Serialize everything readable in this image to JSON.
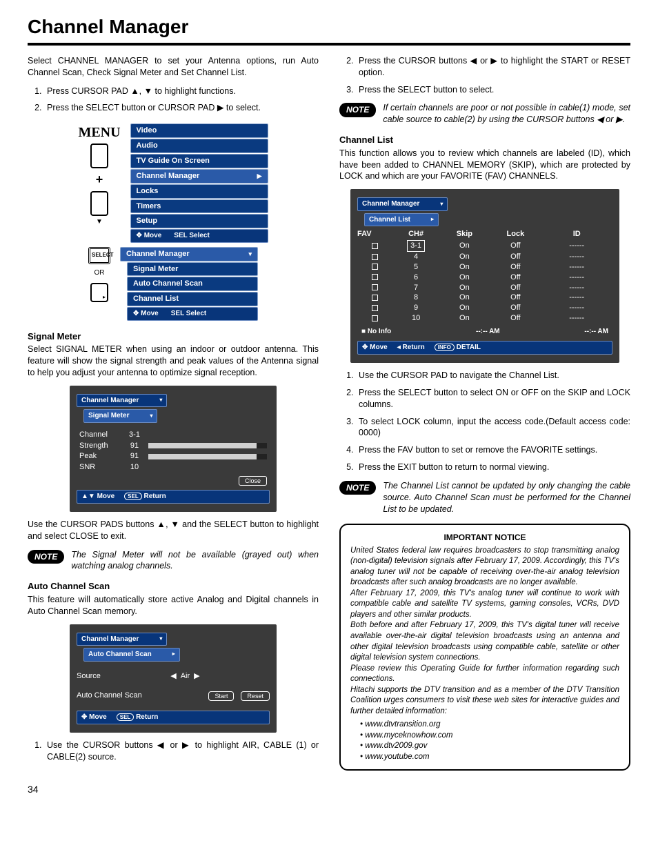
{
  "page": {
    "title": "Channel Manager",
    "number": "34"
  },
  "left": {
    "intro": "Select CHANNEL MANAGER to set your Antenna options, run Auto Channel Scan, Check Signal Meter and Set Channel List.",
    "step1": "Press CURSOR PAD ▲, ▼ to highlight functions.",
    "step2": "Press the SELECT button or CURSOR PAD ▶ to select.",
    "menu_word": "MENU",
    "menu_items": {
      "a": "Video",
      "b": "Audio",
      "c": "TV Guide On Screen",
      "d": "Channel Manager",
      "e": "Locks",
      "f": "Timers",
      "g": "Setup"
    },
    "menu_hint_move": "Move",
    "menu_hint_select": "Select",
    "sel_badge": "SEL",
    "select_label": "SELECT",
    "or_label": "OR",
    "sub_title": "Channel Manager",
    "sub_items": {
      "a": "Signal Meter",
      "b": "Auto Channel Scan",
      "c": "Channel List"
    },
    "sig_head": "Signal Meter",
    "sig_text": "Select SIGNAL METER when using an indoor or outdoor antenna. This feature will show the signal strength and peak values of the Antenna signal to help you adjust your antenna to optimize signal reception.",
    "sig_panel": {
      "crumb1": "Channel Manager",
      "crumb2": "Signal Meter",
      "r1l": "Channel",
      "r1v": "3-1",
      "r2l": "Strength",
      "r2v": "91",
      "r3l": "Peak",
      "r3v": "91",
      "r4l": "SNR",
      "r4v": "10",
      "close": "Close",
      "move": "Move",
      "return": "Return"
    },
    "sig_after": "Use the CURSOR PADS buttons ▲, ▼ and the SELECT button to highlight and select CLOSE to exit.",
    "sig_note": "The Signal Meter will not be available (grayed out) when watching analog channels.",
    "acs_head": "Auto Channel Scan",
    "acs_text": "This feature will automatically store active Analog and Digital channels in Auto Channel Scan memory.",
    "acs_panel": {
      "crumb1": "Channel Manager",
      "crumb2": "Auto Channel Scan",
      "source": "Source",
      "air": "Air",
      "label": "Auto Channel Scan",
      "start": "Start",
      "reset": "Reset",
      "move": "Move",
      "return": "Return"
    },
    "acs_step1": "Use the CURSOR buttons ◀ or ▶ to highlight AIR, CABLE (1) or CABLE(2) source."
  },
  "right": {
    "acs_step2": "Press the CURSOR buttons ◀ or ▶ to highlight the START or RESET option.",
    "acs_step3": "Press the SELECT button to select.",
    "acs_note": "If certain channels are poor or not possible in cable(1) mode, set cable source to cable(2) by using the CURSOR buttons ◀ or ▶.",
    "cl_head": "Channel List",
    "cl_text": "This function allows you to review which channels are labeled (ID), which have been added to CHANNEL MEMORY (SKIP), which are protected by LOCK and which are your FAVORITE (FAV) CHANNELS.",
    "cl_panel": {
      "crumb1": "Channel Manager",
      "crumb2": "Channel List",
      "h_fav": "FAV",
      "h_ch": "CH#",
      "h_skip": "Skip",
      "h_lock": "Lock",
      "h_id": "ID",
      "rows": [
        {
          "ch": "3-1",
          "skip": "On",
          "lock": "Off",
          "id": "------",
          "sel": true
        },
        {
          "ch": "4",
          "skip": "On",
          "lock": "Off",
          "id": "------"
        },
        {
          "ch": "5",
          "skip": "On",
          "lock": "Off",
          "id": "------"
        },
        {
          "ch": "6",
          "skip": "On",
          "lock": "Off",
          "id": "------"
        },
        {
          "ch": "7",
          "skip": "On",
          "lock": "Off",
          "id": "------"
        },
        {
          "ch": "8",
          "skip": "On",
          "lock": "Off",
          "id": "------"
        },
        {
          "ch": "9",
          "skip": "On",
          "lock": "Off",
          "id": "------"
        },
        {
          "ch": "10",
          "skip": "On",
          "lock": "Off",
          "id": "------"
        }
      ],
      "noinfo": "No Info",
      "time1": "--:-- AM",
      "time2": "--:-- AM",
      "move": "Move",
      "return": "Return",
      "detail": "DETAIL",
      "info": "INFO"
    },
    "cl_s1": "Use the CURSOR PAD to navigate the Channel List.",
    "cl_s2": "Press the SELECT button to select ON or OFF on the SKIP and LOCK columns.",
    "cl_s3": "To select LOCK column, input the access code.(Default access code: 0000)",
    "cl_s4": "Press the FAV button to set or remove the FAVORITE settings.",
    "cl_s5": "Press the EXIT button to return to normal viewing.",
    "cl_note": "The Channel List cannot be updated by only changing the cable source. Auto Channel Scan must be performed for the Channel List to be updated.",
    "notice": {
      "title": "IMPORTANT NOTICE",
      "p1": "United States federal law requires broadcasters to stop transmitting analog (non-digital) television signals after February 17, 2009.",
      "p2": "Accordingly, this TV's analog tuner will not be capable of receiving over-the-air analog television broadcasts after such analog broadcasts are no longer available.",
      "p3": "After February 17, 2009, this TV's analog tuner will continue to work with compatible cable and satellite TV systems, gaming consoles, VCRs, DVD players and other similar products.",
      "p4": "Both before and after February 17, 2009, this TV's digital tuner will receive available over-the-air digital television broadcasts using an antenna and other digital television broadcasts using compatible cable, satellite or other digital television system connections.",
      "p5": "Please review this Operating Guide for further information regarding such connections.",
      "p6": "Hitachi supports the DTV transition and as a member of the DTV Transition Coalition urges consumers to visit these web sites for interactive guides and further detailed information:",
      "links": {
        "a": "www.dtvtransition.org",
        "b": "www.myceknowhow.com",
        "c": "www.dtv2009.gov",
        "d": "www.youtube.com"
      }
    }
  },
  "note_label": "NOTE"
}
